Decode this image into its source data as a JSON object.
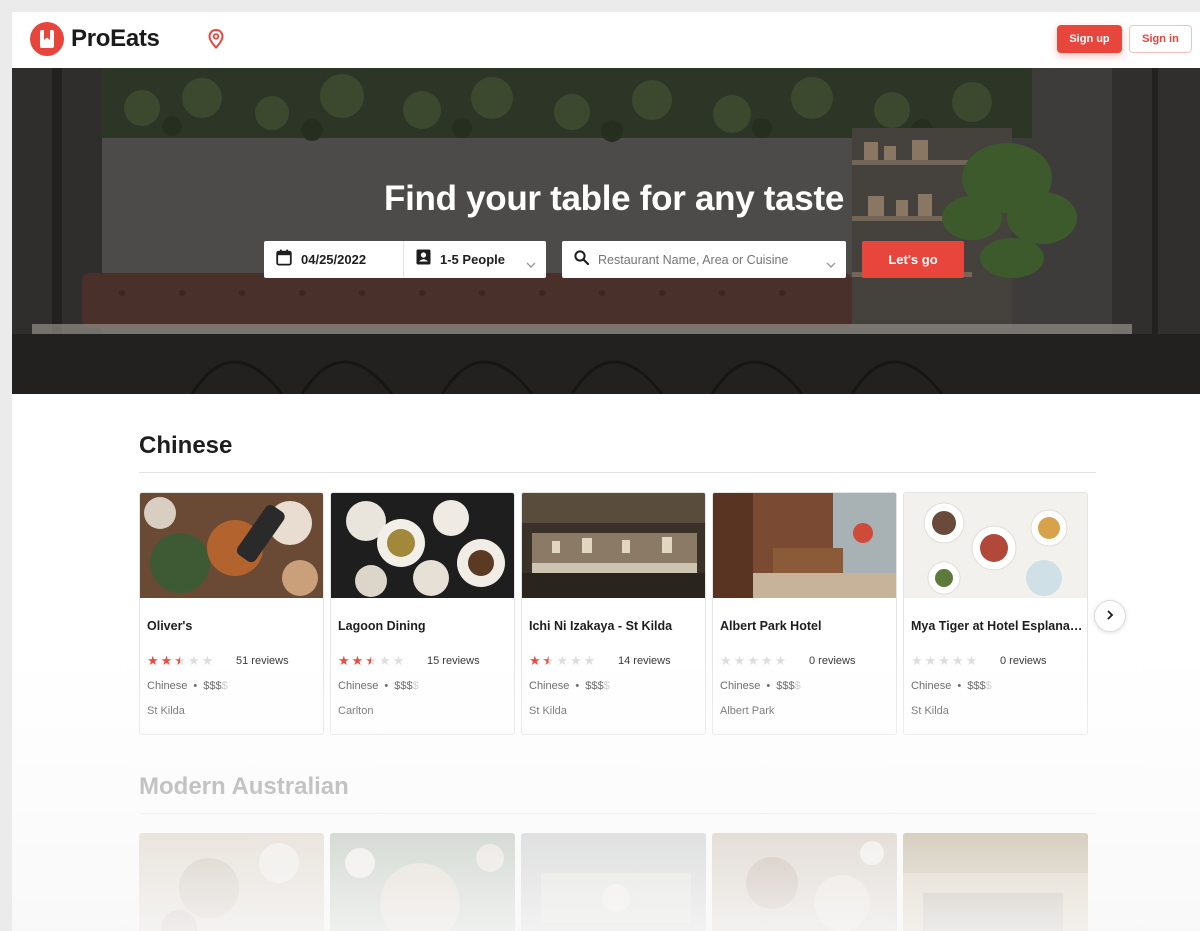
{
  "brand": {
    "name": "ProEats",
    "color": "#e8453c"
  },
  "header": {
    "signup_label": "Sign up",
    "signin_label": "Sign in"
  },
  "hero": {
    "title": "Find your table for any taste",
    "date_value": "04/25/2022",
    "people_value": "1-5 People",
    "search_placeholder": "Restaurant Name, Area or Cuisine",
    "go_label": "Let's go"
  },
  "sections": [
    {
      "title": "Chinese",
      "restaurants": [
        {
          "name": "Oliver's",
          "rating": 2.5,
          "reviews": "51 reviews",
          "cuisine": "Chinese",
          "price_on": "$$$",
          "price_off": "$",
          "area": "St Kilda"
        },
        {
          "name": "Lagoon Dining",
          "rating": 2.5,
          "reviews": "15 reviews",
          "cuisine": "Chinese",
          "price_on": "$$$",
          "price_off": "$",
          "area": "Carlton"
        },
        {
          "name": "Ichi Ni Izakaya - St Kilda",
          "rating": 1.5,
          "reviews": "14 reviews",
          "cuisine": "Chinese",
          "price_on": "$$$",
          "price_off": "$",
          "area": "St Kilda"
        },
        {
          "name": "Albert Park Hotel",
          "rating": 0,
          "reviews": "0 reviews",
          "cuisine": "Chinese",
          "price_on": "$$$",
          "price_off": "$",
          "area": "Albert Park"
        },
        {
          "name": "Mya Tiger at Hotel Esplanade",
          "rating": 0,
          "reviews": "0 reviews",
          "cuisine": "Chinese",
          "price_on": "$$$",
          "price_off": "$",
          "area": "St Kilda"
        }
      ]
    },
    {
      "title": "Modern Australian"
    }
  ],
  "separator": "•"
}
